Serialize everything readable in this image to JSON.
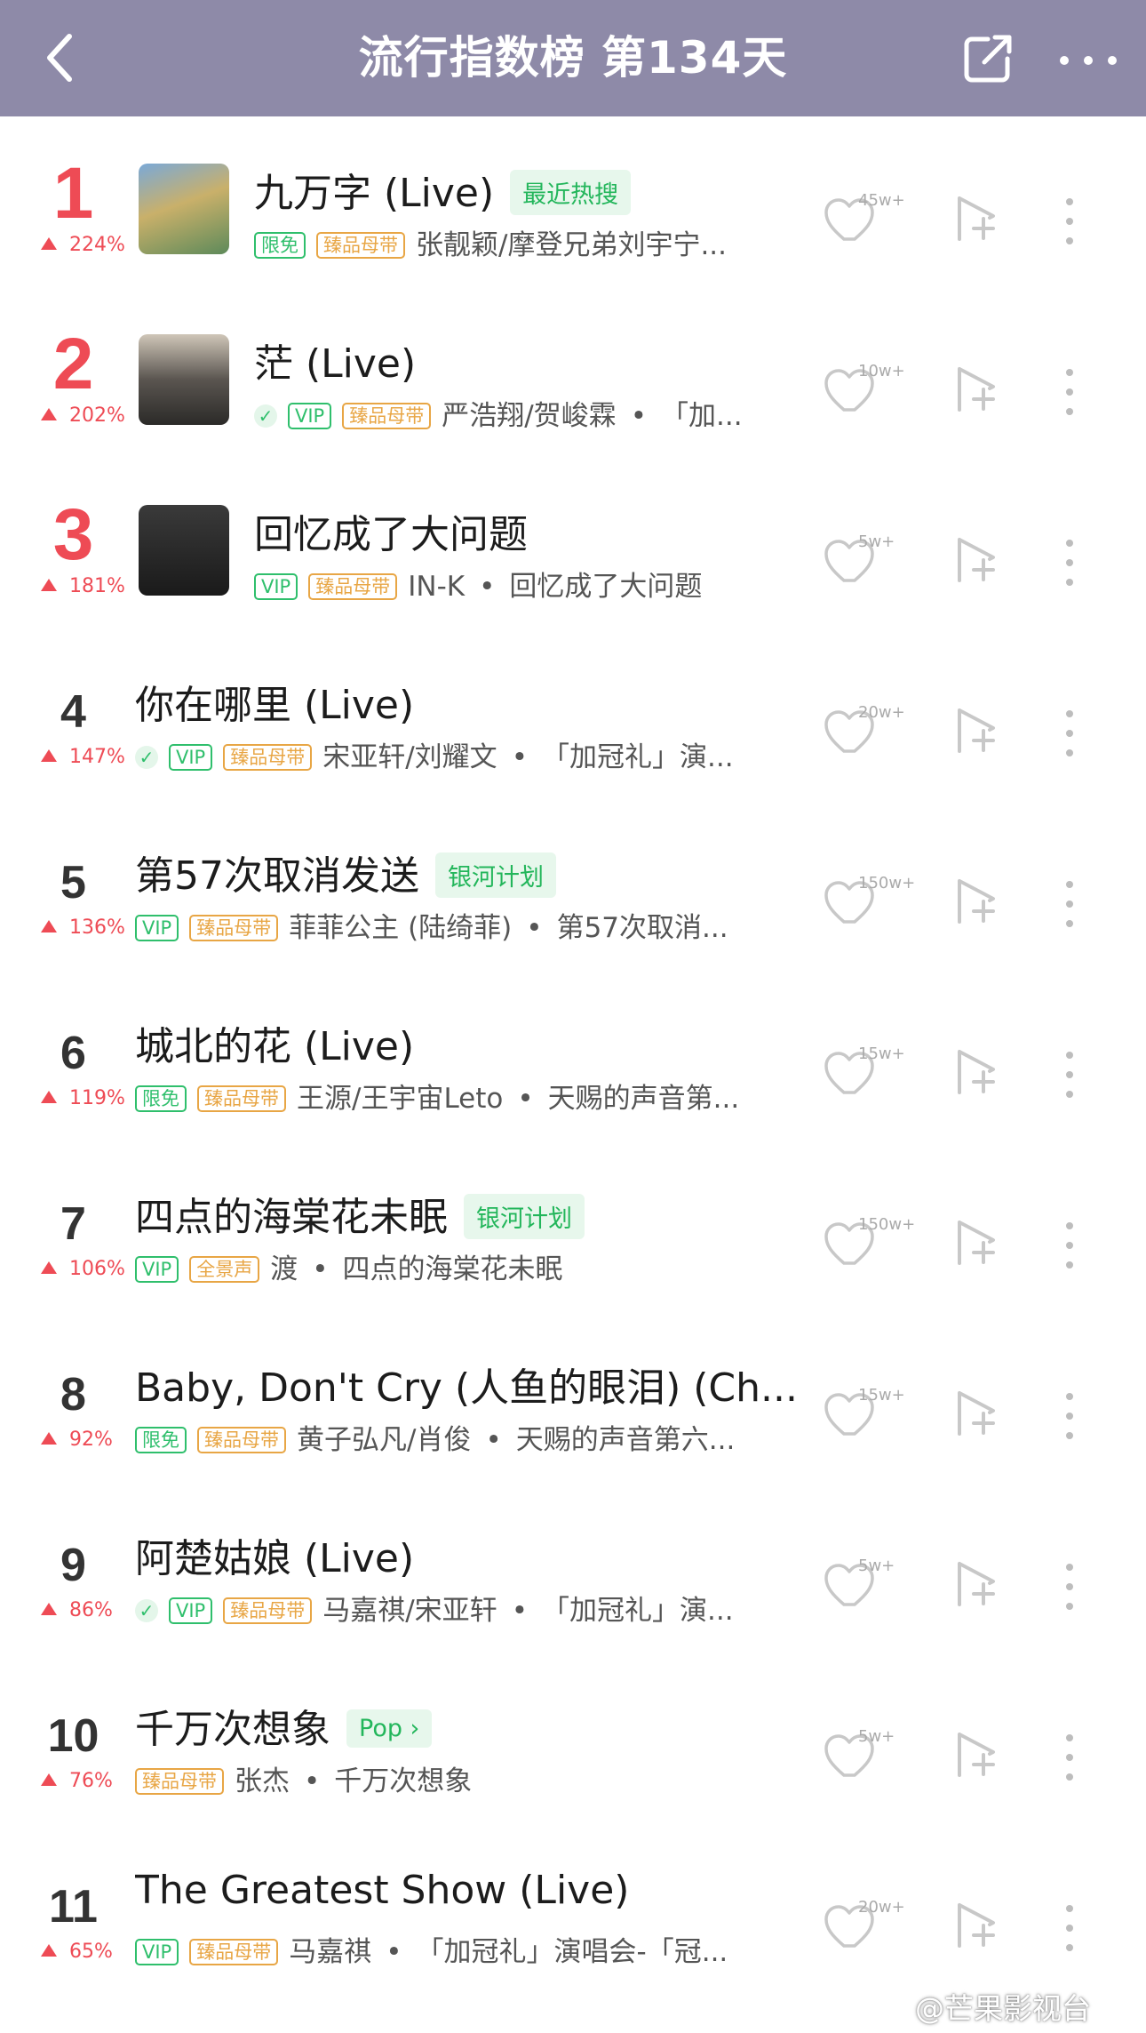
{
  "header": {
    "title": "流行指数榜 第134天"
  },
  "icons": {
    "back": "chevron-left-icon",
    "share": "share-icon",
    "more": "more-icon",
    "like": "heart-icon",
    "add": "add-to-playlist-icon",
    "row_more": "vertical-more-icon"
  },
  "colors": {
    "header_bg": "#8e8aa8",
    "rank_up": "#ee4b55",
    "tag_green": "#23b65b",
    "badge_orange": "#e8a645"
  },
  "rows": [
    {
      "rank": "1",
      "change": "224%",
      "title": "九万字 (Live)",
      "tag": "最近热搜",
      "badges": [
        "限免",
        "臻品母带"
      ],
      "artist": "张靓颖/摩登兄弟刘宇宁...",
      "album": "",
      "likes": "45w+"
    },
    {
      "rank": "2",
      "change": "202%",
      "title": "茫 (Live)",
      "tag": "",
      "badges": [
        "✓",
        "VIP",
        "臻品母带"
      ],
      "artist": "严浩翔/贺峻霖",
      "album": "「加...",
      "likes": "10w+"
    },
    {
      "rank": "3",
      "change": "181%",
      "title": "回忆成了大问题",
      "tag": "",
      "badges": [
        "VIP",
        "臻品母带"
      ],
      "artist": "IN-K",
      "album": "回忆成了大问题",
      "likes": "5w+"
    },
    {
      "rank": "4",
      "change": "147%",
      "title": "你在哪里 (Live)",
      "tag": "",
      "badges": [
        "✓",
        "VIP",
        "臻品母带"
      ],
      "artist": "宋亚轩/刘耀文",
      "album": "「加冠礼」演...",
      "likes": "20w+"
    },
    {
      "rank": "5",
      "change": "136%",
      "title": "第57次取消发送",
      "tag": "银河计划",
      "badges": [
        "VIP",
        "臻品母带"
      ],
      "artist": "菲菲公主 (陆绮菲)",
      "album": "第57次取消...",
      "likes": "150w+"
    },
    {
      "rank": "6",
      "change": "119%",
      "title": "城北的花 (Live)",
      "tag": "",
      "badges": [
        "限免",
        "臻品母带"
      ],
      "artist": "王源/王宇宙Leto",
      "album": "天赐的声音第...",
      "likes": "15w+"
    },
    {
      "rank": "7",
      "change": "106%",
      "title": "四点的海棠花未眠",
      "tag": "银河计划",
      "badges": [
        "VIP",
        "全景声"
      ],
      "artist": "渡",
      "album": "四点的海棠花未眠",
      "likes": "150w+"
    },
    {
      "rank": "8",
      "change": "92%",
      "title": "Baby, Don't Cry (人鱼的眼泪) (Ch...",
      "tag": "",
      "badges": [
        "限免",
        "臻品母带"
      ],
      "artist": "黄子弘凡/肖俊",
      "album": "天赐的声音第六...",
      "likes": "15w+"
    },
    {
      "rank": "9",
      "change": "86%",
      "title": "阿楚姑娘 (Live)",
      "tag": "",
      "badges": [
        "✓",
        "VIP",
        "臻品母带"
      ],
      "artist": "马嘉祺/宋亚轩",
      "album": "「加冠礼」演...",
      "likes": "5w+"
    },
    {
      "rank": "10",
      "change": "76%",
      "title": "千万次想象",
      "tag": "Pop ›",
      "badges": [
        "臻品母带"
      ],
      "artist": "张杰",
      "album": "千万次想象",
      "likes": "5w+"
    },
    {
      "rank": "11",
      "change": "65%",
      "title": "The Greatest Show (Live)",
      "tag": "",
      "badges": [
        "VIP",
        "臻品母带"
      ],
      "artist": "马嘉祺",
      "album": "「加冠礼」演唱会-「冠...",
      "likes": "20w+"
    }
  ],
  "watermark": "@芒果影视台"
}
